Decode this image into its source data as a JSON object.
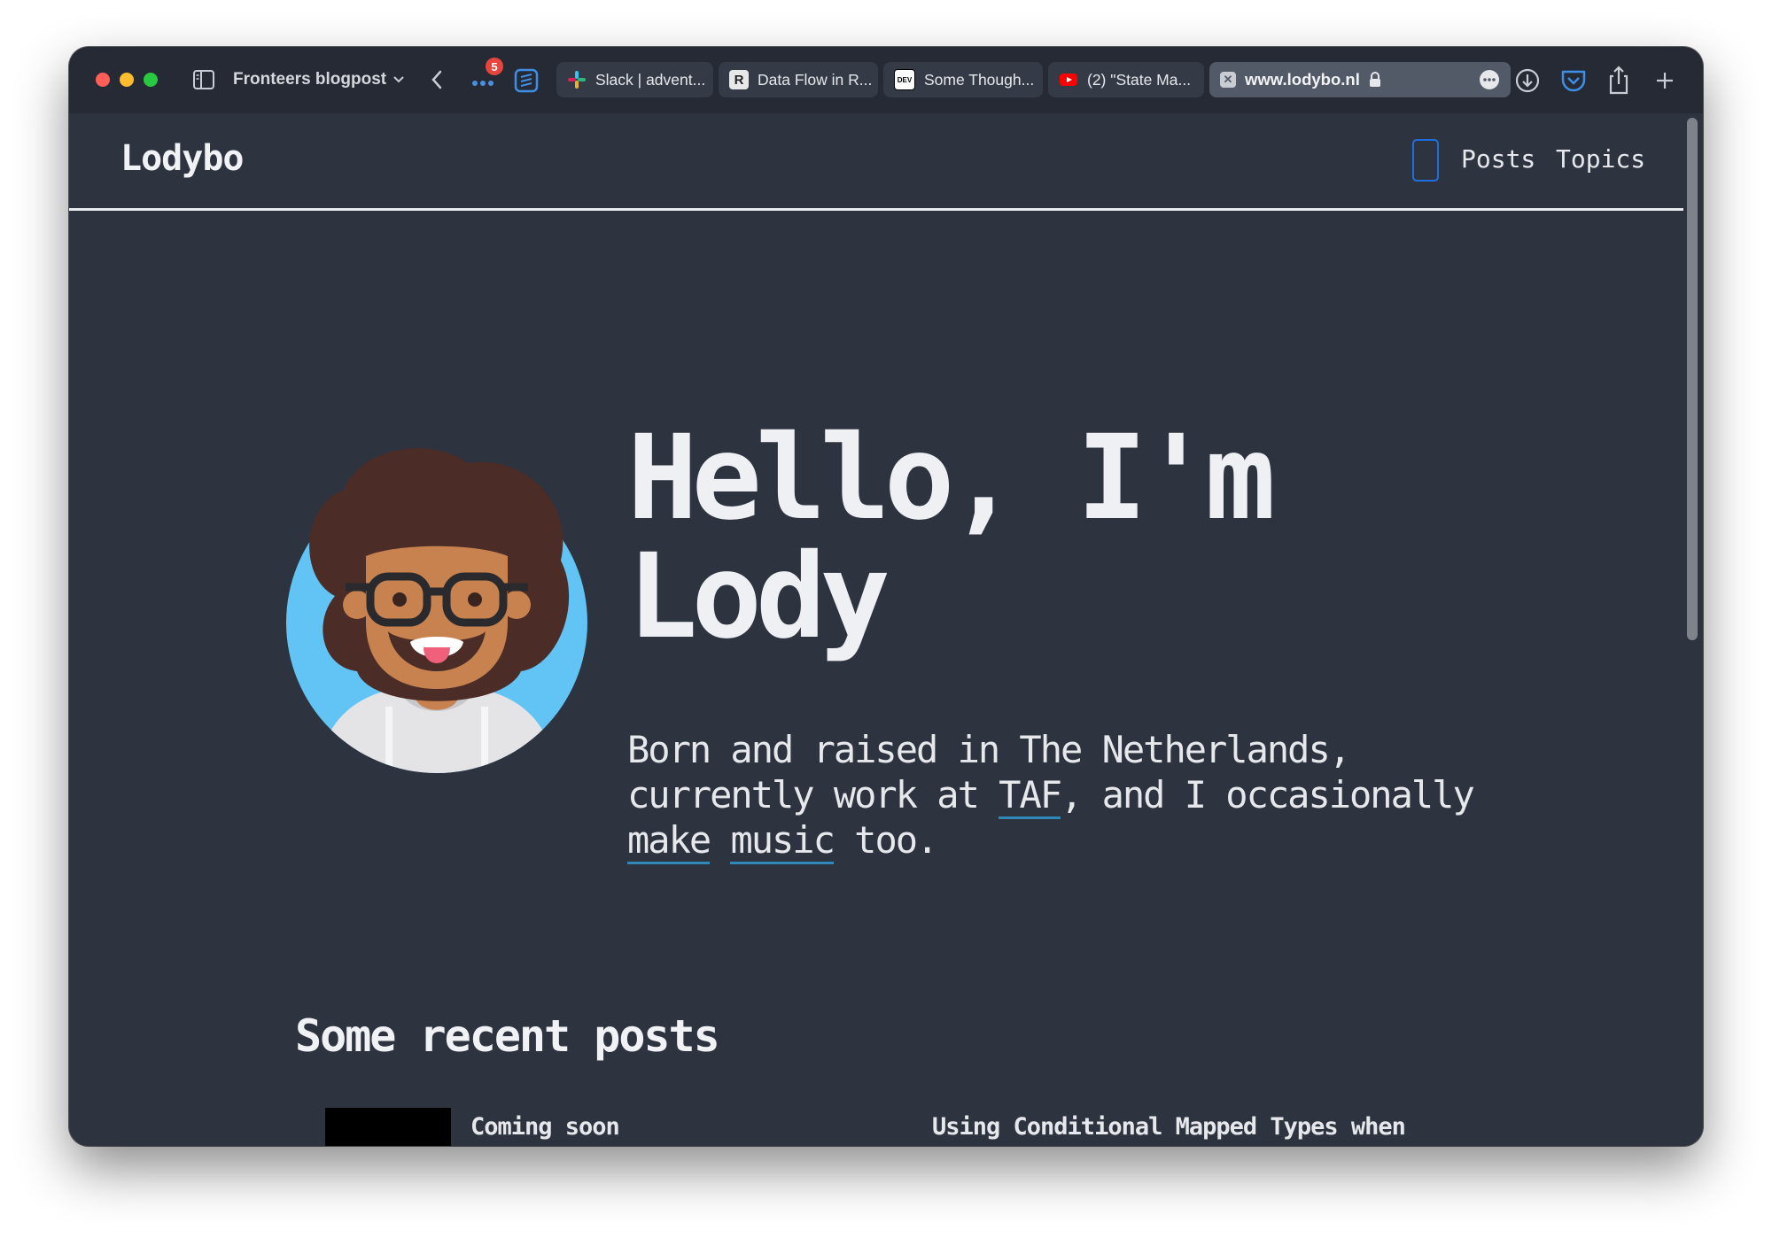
{
  "browser": {
    "tab_group": "Fronteers blogpost",
    "extension_badge": "5",
    "tabs": [
      {
        "label": "Slack | advent...",
        "favicon": "slack-icon"
      },
      {
        "label": "Data Flow in R...",
        "favicon": "r-icon",
        "favicon_text": "R"
      },
      {
        "label": "Some Though...",
        "favicon": "dev-icon",
        "favicon_text": "DEV"
      },
      {
        "label": "(2) \"State Ma...",
        "favicon": "youtube-icon"
      }
    ],
    "active_url": "www.lodybo.nl",
    "colors": {
      "toolbar": "#252a35",
      "tab": "#343a46",
      "active_tab": "#535a67",
      "badge": "#e5453c"
    }
  },
  "site": {
    "brand": "Lodybo",
    "nav": {
      "posts": "Posts",
      "topics": "Topics"
    },
    "hero": {
      "title_line1": "Hello, I'm",
      "title_line2": "Lody",
      "subtitle_part1": "Born and raised in The Netherlands, currently work at ",
      "link_taf": "TAF",
      "subtitle_part2": ", and I occasionally ",
      "link_make": "make",
      "subtitle_part3": " ",
      "link_music": "music",
      "subtitle_part4": " too."
    },
    "recent_posts_title": "Some recent posts",
    "posts": [
      {
        "title": "Coming soon"
      },
      {
        "title": "Using Conditional Mapped Types when"
      }
    ],
    "colors": {
      "background": "#2e3340",
      "text": "#eef0f4",
      "link_underline": "#2f88b7",
      "toggle_border": "#1f6fe0"
    }
  }
}
